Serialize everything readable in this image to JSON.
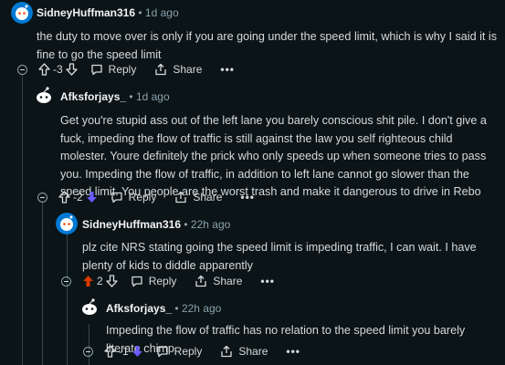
{
  "comments": [
    {
      "author": "SidneyHuffman316",
      "time": "1d ago",
      "body": "the duty to move over is only if you are going under the speed limit, which is why I said it is fine to go the speed limit",
      "score": "-3",
      "reply_label": "Reply",
      "share_label": "Share",
      "more_label": "•••",
      "vote_state": "down"
    },
    {
      "author": "Afksforjays_",
      "time": "1d ago",
      "body": "Get you're stupid ass out of the left lane you barely conscious shit pile. I don't give a fuck, impeding the flow of traffic is still against the law you self righteous child molester. Youre definitely the prick who only speeds up when someone tries to pass you. Impeding the flow of traffic, in addition to left lane cannot go slower than the speed limit. You people are the worst trash and make it dangerous to drive in Rebo",
      "score": "-2",
      "reply_label": "Reply",
      "share_label": "Share",
      "more_label": "•••",
      "vote_state": "down"
    },
    {
      "author": "SidneyHuffman316",
      "time": "22h ago",
      "body": "plz cite NRS stating going the speed limit is impeding traffic, I can wait. I have plenty of kids to diddle apparently",
      "score": "2",
      "reply_label": "Reply",
      "share_label": "Share",
      "more_label": "•••",
      "vote_state": "up"
    },
    {
      "author": "Afksforjays_",
      "time": "22h ago",
      "body": "Impeding the flow of traffic has no relation to the speed limit you barely literate chimp",
      "score": "-1",
      "reply_label": "Reply",
      "share_label": "Share",
      "more_label": "•••",
      "vote_state": "down"
    }
  ],
  "colors": {
    "background": "#0b1416",
    "upvote_active": "#d93a00",
    "downvote_active": "#6a5cff",
    "muted": "#8ba2ad"
  },
  "icons": {
    "upvote": "arrow-up-icon",
    "downvote": "arrow-down-icon",
    "reply": "speech-bubble-icon",
    "share": "share-icon",
    "collapse": "collapse-minus-icon",
    "avatar_snoo": "snoo-avatar-icon"
  },
  "separator": "•"
}
